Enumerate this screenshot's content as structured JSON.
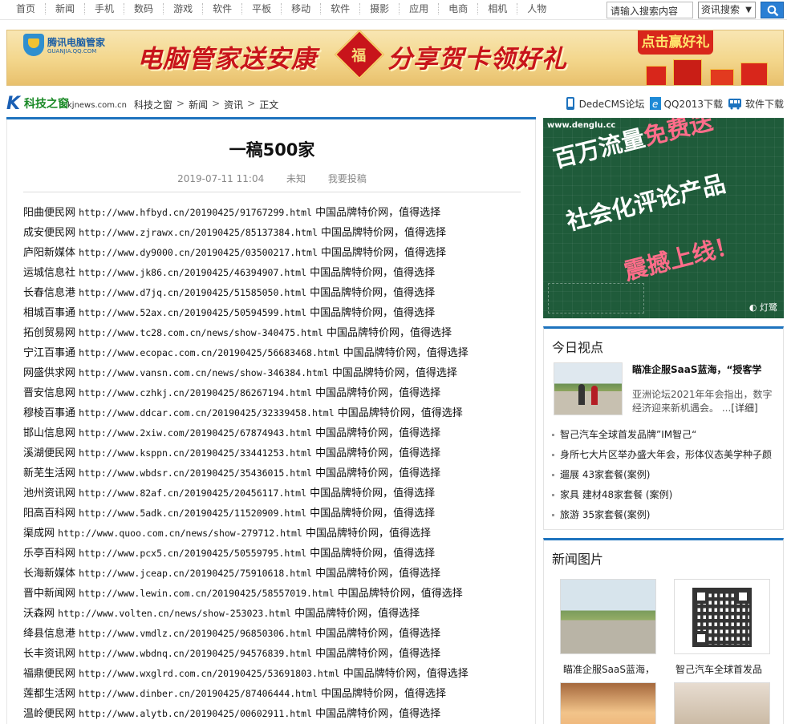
{
  "nav": {
    "links": [
      "首页",
      "新闻",
      "手机",
      "数码",
      "游戏",
      "软件",
      "平板",
      "移动",
      "软件",
      "摄影",
      "应用",
      "电商",
      "相机",
      "人物"
    ],
    "search_value": "请输入搜索内容",
    "search_select": "资讯搜索"
  },
  "banner": {
    "logo_name": "腾讯电脑管家",
    "logo_sub": "GUANJIA.QQ.COM",
    "slogan_left": "电脑管家送安康",
    "fu": "福",
    "slogan_right": "分享贺卡领好礼",
    "cta": "点击赢好礼"
  },
  "header": {
    "logo_k": "K",
    "logo_cn": "科技之窗",
    "logo_domain": "kjnews.com.cn",
    "crumbs": [
      "科技之窗",
      "新闻",
      "资讯",
      "正文"
    ],
    "quicklinks": [
      "DedeCMS论坛",
      "QQ2013下载",
      "软件下载"
    ]
  },
  "article": {
    "title": "一稿500家",
    "date": "2019-07-11 11:04",
    "author": "未知",
    "submit": "我要投稿",
    "suffix": "中国品牌特价网，值得选择",
    "rows": [
      {
        "site": "阳曲便民网",
        "url": "http://www.hfbyd.cn/20190425/91767299.html"
      },
      {
        "site": "成安便民网",
        "url": "http://www.zjrawx.cn/20190425/85137384.html"
      },
      {
        "site": "庐阳新媒体",
        "url": "http://www.dy9000.cn/20190425/03500217.html"
      },
      {
        "site": "运城信息社",
        "url": "http://www.jk86.cn/20190425/46394907.html"
      },
      {
        "site": "长春信息港",
        "url": "http://www.d7jq.cn/20190425/51585050.html"
      },
      {
        "site": "相城百事通",
        "url": "http://www.52ax.cn/20190425/50594599.html"
      },
      {
        "site": "拓创贸易网",
        "url": "http://www.tc28.com.cn/news/show-340475.html"
      },
      {
        "site": "宁江百事通",
        "url": "http://www.ecopac.com.cn/20190425/56683468.html"
      },
      {
        "site": "网盛供求网",
        "url": "http://www.vansn.com.cn/news/show-346384.html"
      },
      {
        "site": "晋安信息网",
        "url": "http://www.czhkj.cn/20190425/86267194.html"
      },
      {
        "site": "穆棱百事通",
        "url": "http://www.ddcar.com.cn/20190425/32339458.html"
      },
      {
        "site": "邯山信息网",
        "url": "http://www.2xiw.com/20190425/67874943.html"
      },
      {
        "site": "溪湖便民网",
        "url": "http://www.ksppn.cn/20190425/33441253.html"
      },
      {
        "site": "新芜生活网",
        "url": "http://www.wbdsr.cn/20190425/35436015.html"
      },
      {
        "site": "池州资讯网",
        "url": "http://www.82af.cn/20190425/20456117.html"
      },
      {
        "site": "阳高百科网",
        "url": "http://www.5adk.cn/20190425/11520909.html"
      },
      {
        "site": "渠成网",
        "url": "http://www.quoo.com.cn/news/show-279712.html"
      },
      {
        "site": "乐亭百科网",
        "url": "http://www.pcx5.cn/20190425/50559795.html"
      },
      {
        "site": "长海新媒体",
        "url": "http://www.jceap.cn/20190425/75910618.html"
      },
      {
        "site": "晋中新闻网",
        "url": "http://www.lewin.com.cn/20190425/58557019.html"
      },
      {
        "site": "沃森网",
        "url": "http://www.volten.cn/news/show-253023.html"
      },
      {
        "site": "绛县信息港",
        "url": "http://www.vmdlz.cn/20190425/96850306.html"
      },
      {
        "site": "长丰资讯网",
        "url": "http://www.wbdnq.cn/20190425/94576839.html"
      },
      {
        "site": "福鼎便民网",
        "url": "http://www.wxglrd.com.cn/20190425/53691803.html"
      },
      {
        "site": "莲都生活网",
        "url": "http://www.dinber.cn/20190425/87406444.html"
      },
      {
        "site": "温岭便民网",
        "url": "http://www.alytb.cn/20190425/00602911.html"
      }
    ]
  },
  "ad_right": {
    "domain": "www.denglu.cc",
    "line1_a": "百万流量",
    "line1_b": "免费送",
    "line2": "社会化评论产品",
    "line3": "震撼上线！",
    "brand": "灯鹭"
  },
  "today": {
    "heading": "今日视点",
    "feature_title": "瞄准企服SaaS蓝海，“授客学",
    "feature_desc": "亚洲论坛2021年年会指出，数字经济迎来新机遇会。 ...",
    "feature_more": "[详细]",
    "items": [
      "智己汽车全球首发品牌”IM智己“",
      "身所七大片区举办盛大年会，形体仪态美学种子颜",
      "遛展 43家套餐(案例)",
      "家具 建材48家套餐 (案例)",
      "旅游 35家套餐(案例)"
    ]
  },
  "photos": {
    "heading": "新闻图片",
    "captions": [
      "瞄准企服SaaS蓝海，",
      "智己汽车全球首发品"
    ]
  },
  "colors": {
    "accent_blue": "#1e73be",
    "banner_red": "#c8141b",
    "ad_green": "#1f5b3a"
  }
}
